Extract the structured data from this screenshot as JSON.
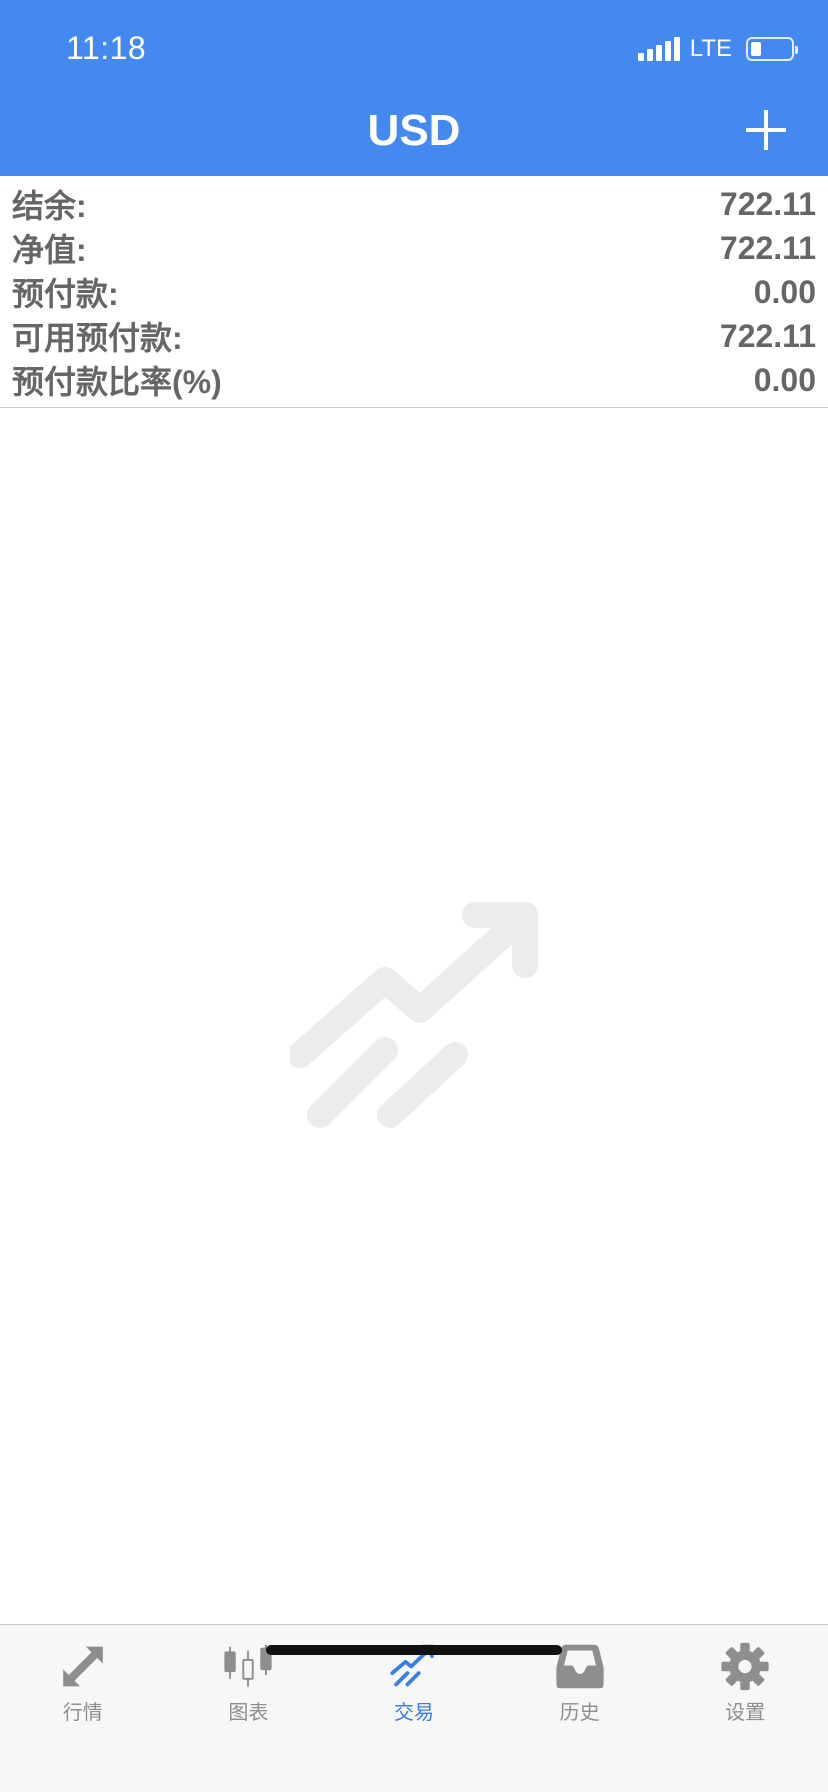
{
  "status_bar": {
    "time": "11:18",
    "network": "LTE"
  },
  "header": {
    "title": "USD"
  },
  "account": {
    "rows": [
      {
        "label": "结余:",
        "value": "722.11"
      },
      {
        "label": "净值:",
        "value": "722.11"
      },
      {
        "label": "预付款:",
        "value": "0.00"
      },
      {
        "label": "可用预付款:",
        "value": "722.11"
      },
      {
        "label": "预付款比率(%)",
        "value": "0.00"
      }
    ]
  },
  "tabs": [
    {
      "label": "行情",
      "icon": "quotes-arrows-icon",
      "active": false
    },
    {
      "label": "图表",
      "icon": "candlestick-chart-icon",
      "active": false
    },
    {
      "label": "交易",
      "icon": "trade-trend-icon",
      "active": true
    },
    {
      "label": "历史",
      "icon": "history-inbox-icon",
      "active": false
    },
    {
      "label": "设置",
      "icon": "gear-icon",
      "active": false
    }
  ],
  "colors": {
    "header_bg": "#4489f0",
    "active_tab": "#3a7de6",
    "inactive_tab": "#8e8e8e",
    "row_text": "#666666",
    "watermark": "#ececec"
  }
}
